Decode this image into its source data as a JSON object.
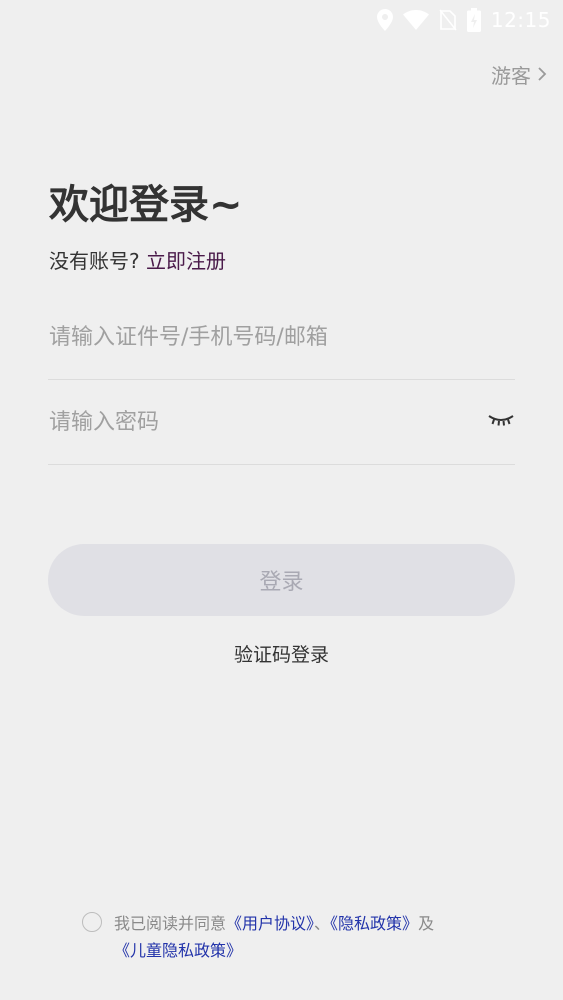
{
  "status_bar": {
    "time": "12:15",
    "icons": [
      "location-icon",
      "wifi-icon",
      "no-sim-icon",
      "battery-charging-icon"
    ]
  },
  "header": {
    "guest_label": "游客",
    "guest_icon": "chevron-right-icon"
  },
  "login": {
    "title": "欢迎登录~",
    "no_account_text": "没有账号? ",
    "register_link": "立即注册",
    "username_placeholder": "请输入证件号/手机号码/邮箱",
    "password_placeholder": "请输入密码",
    "password_toggle_icon": "eye-closed-icon",
    "submit_label": "登录",
    "sms_login_label": "验证码登录"
  },
  "agreement": {
    "prefix": "我已阅读并同意",
    "user_agreement": "《用户协议》",
    "separator": "、",
    "privacy_policy": "《隐私政策》",
    "and": "及",
    "children_privacy_policy": "《儿童隐私政策》"
  },
  "colors": {
    "background": "#efefef",
    "link": "#2233aa",
    "register_link": "#4a1a4a",
    "button_bg": "#e0e0e5",
    "button_text": "#a9a9b3"
  }
}
